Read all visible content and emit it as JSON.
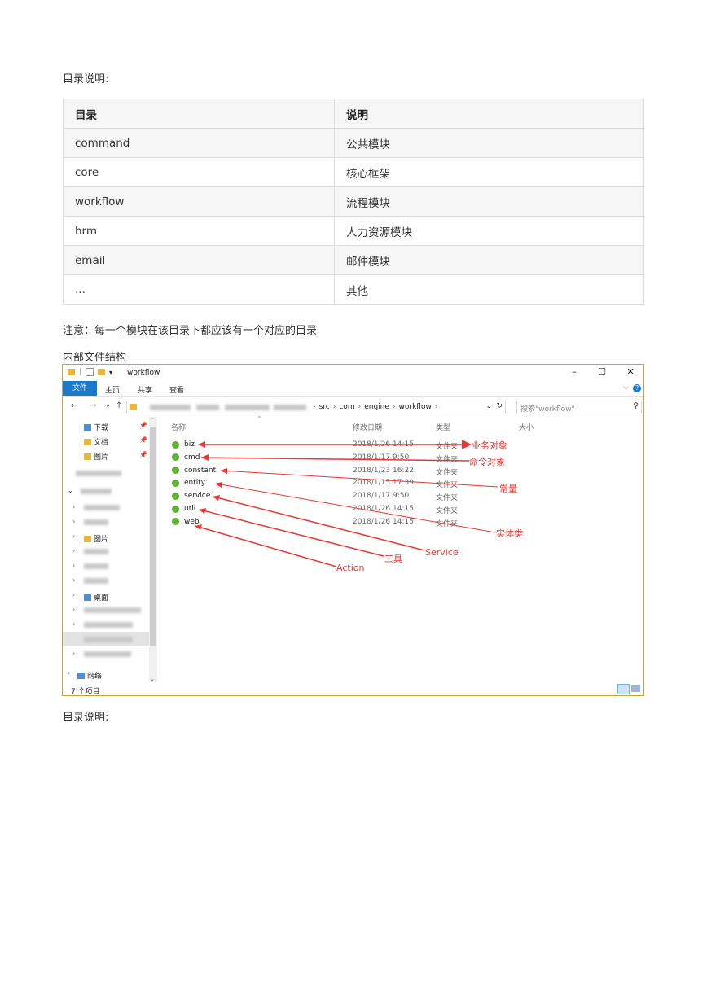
{
  "intro_label": "目录说明:",
  "table": {
    "headers": [
      "目录",
      "说明"
    ],
    "rows": [
      [
        "command",
        "公共模块"
      ],
      [
        "core",
        "核心框架"
      ],
      [
        "workflow",
        "流程模块"
      ],
      [
        "hrm",
        "人力资源模块"
      ],
      [
        "email",
        "邮件模块"
      ],
      [
        "...",
        "其他"
      ]
    ]
  },
  "note": "注意：每一个模块在该目录下都应该有一个对应的目录",
  "section_title": "内部文件结构",
  "explorer": {
    "title": "workflow",
    "ribbon_tabs": [
      "文件",
      "主页",
      "共享",
      "查看"
    ],
    "breadcrumbs": [
      "src",
      "com",
      "engine",
      "workflow"
    ],
    "search_placeholder": "搜索\"workflow\"",
    "quick_access": [
      "下载",
      "文档",
      "图片"
    ],
    "nav_tree": [
      "图片",
      "桌面",
      "网络"
    ],
    "columns": [
      "名称",
      "修改日期",
      "类型",
      "大小"
    ],
    "files": [
      {
        "name": "biz",
        "date": "2018/1/26 14:15",
        "type": "文件夹"
      },
      {
        "name": "cmd",
        "date": "2018/1/17 9:50",
        "type": "文件夹"
      },
      {
        "name": "constant",
        "date": "2018/1/23 16:22",
        "type": "文件夹"
      },
      {
        "name": "entity",
        "date": "2018/1/15 17:39",
        "type": "文件夹"
      },
      {
        "name": "service",
        "date": "2018/1/17 9:50",
        "type": "文件夹"
      },
      {
        "name": "util",
        "date": "2018/1/26 14:15",
        "type": "文件夹"
      },
      {
        "name": "web",
        "date": "2018/1/26 14:15",
        "type": "文件夹"
      }
    ],
    "status": "7 个项目"
  },
  "annotations": [
    "业务对象",
    "命令对象",
    "常量",
    "实体类",
    "Service",
    "工具",
    "Action"
  ],
  "footer_label": "目录说明:"
}
